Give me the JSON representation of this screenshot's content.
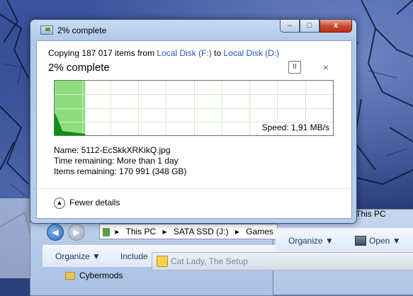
{
  "dialog": {
    "title": "2% complete",
    "copy_prefix": "Copying 187 017 items from",
    "source": "Local Disk (F:)",
    "to_word": "to",
    "destination": "Local Disk (D:)",
    "status": "2% complete",
    "progress_percent": 2,
    "speed_label": "Speed: 1,91 MB/s",
    "name_row": "Name:  5112-EcSkkXRKikQ.jpg",
    "time_row": "Time remaining:  More than 1 day",
    "items_row": "Items remaining:  170 991 (348 GB)",
    "fewer_details": "Fewer details",
    "buttons": {
      "minimize": "–",
      "maximize": "□",
      "close": "x",
      "pause": "II",
      "cancel": "×"
    }
  },
  "background": {
    "breadcrumb": [
      "This PC",
      "SATA SSD (J:)",
      "Games"
    ],
    "left_toolbar": {
      "organize": "Organize ▼",
      "include": "Include"
    },
    "right_toolbar": {
      "organize": "Organize ▼",
      "open": "Open ▼"
    },
    "right_tab": "This PC",
    "taskbar_window": "Cat Lady, The Setup",
    "tree_item": "Cybermods"
  },
  "colors": {
    "graph_fill": "#0e8f16",
    "graph_progress": "#8fdc7f",
    "link": "#1c56b8",
    "close_button": "#c8482f"
  }
}
